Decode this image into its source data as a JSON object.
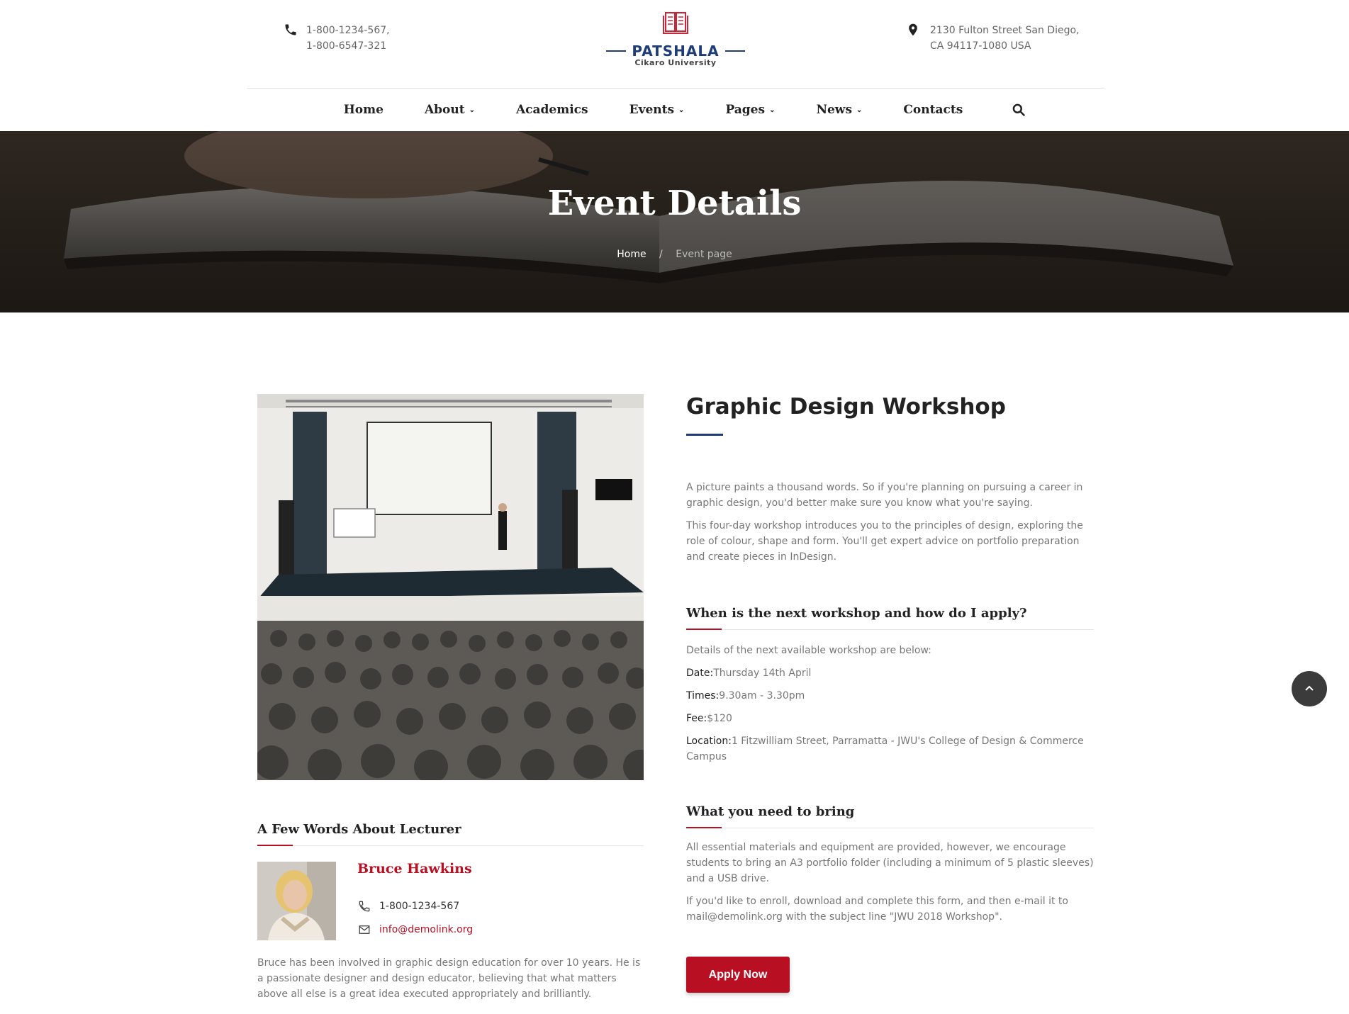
{
  "header": {
    "phone_lines": [
      "1-800-1234-567,",
      "1-800-6547-321"
    ],
    "address_lines": [
      "2130 Fulton Street San Diego,",
      "CA 94117-1080 USA"
    ],
    "logo_name": "PATSHALA",
    "logo_sub": "Cikaro University"
  },
  "nav": {
    "items": [
      {
        "label": "Home",
        "has_dropdown": false
      },
      {
        "label": "About",
        "has_dropdown": true
      },
      {
        "label": "Academics",
        "has_dropdown": false
      },
      {
        "label": "Events",
        "has_dropdown": true
      },
      {
        "label": "Pages",
        "has_dropdown": true
      },
      {
        "label": "News",
        "has_dropdown": true
      },
      {
        "label": "Contacts",
        "has_dropdown": false
      }
    ]
  },
  "hero": {
    "title": "Event Details",
    "breadcrumb_home": "Home",
    "breadcrumb_sep": "/",
    "breadcrumb_current": "Event page"
  },
  "lecturer": {
    "section_title": "A Few Words About Lecturer",
    "name": "Bruce Hawkins",
    "phone": "1-800-1234-567",
    "email": "info@demolink.org",
    "bio": "Bruce has been involved in graphic design education for over 10 years. He is a passionate designer and design educator, believing that what matters above all else is a great idea executed appropriately and brilliantly."
  },
  "event": {
    "title": "Graphic Design Workshop",
    "intro_1": "A picture paints a thousand words. So if you're planning on pursuing a career in graphic design, you'd better make sure you know what you're saying.",
    "intro_2": "This four-day workshop introduces you to the principles of design, exploring the role of colour, shape and form. You'll get expert advice on portfolio preparation and create pieces in InDesign.",
    "when_title": "When is the next workshop and how do I apply?",
    "details_intro": "Details of the next available workshop are below:",
    "date_label": "Date:",
    "date_value": "Thursday 14th April",
    "times_label": "Times:",
    "times_value": "9.30am - 3.30pm",
    "fee_label": "Fee:",
    "fee_value": "$120",
    "location_label": "Location:",
    "location_value": "1 Fitzwilliam Street, Parramatta - JWU's College of Design & Commerce Campus",
    "bring_title": "What you need to bring",
    "bring_1": "All essential materials and equipment are provided, however, we encourage students to bring an A3 portfolio folder (including a minimum of 5 plastic sleeves) and a USB drive.",
    "bring_2": "If you'd like to enroll, download and complete this form, and then e-mail it to mail@demolink.org with the subject line \"JWU 2018 Workshop\".",
    "apply_label": "Apply Now"
  },
  "colors": {
    "brand_red": "#b80f23",
    "brand_navy": "#1d3c78"
  },
  "icons": {
    "phone": "phone-icon",
    "location": "map-pin-icon",
    "search": "search-icon",
    "mail": "mail-icon",
    "back_to_top": "chevron-up-icon",
    "logo": "open-book-icon"
  }
}
